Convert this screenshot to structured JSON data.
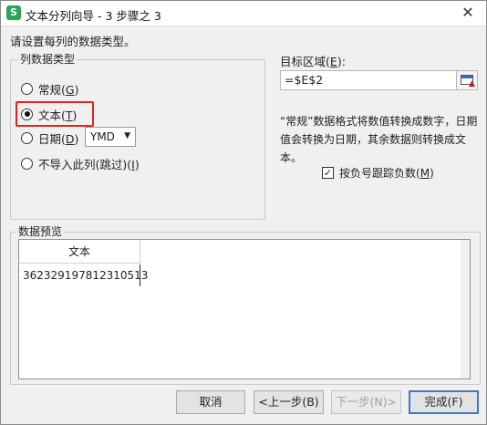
{
  "window": {
    "title": "文本分列向导 - 3 步骤之 3",
    "app_icon": "S",
    "close_glyph": "✕"
  },
  "instruction": "请设置每列的数据类型。",
  "column_type": {
    "legend": "列数据类型",
    "options": [
      {
        "label": "常规",
        "key": "G",
        "checked": false
      },
      {
        "label": "文本",
        "key": "T",
        "checked": true
      },
      {
        "label": "日期",
        "key": "D",
        "checked": false
      },
      {
        "label": "不导入此列(跳过)",
        "key": "I",
        "checked": false
      }
    ],
    "date_format": "YMD"
  },
  "destination": {
    "label": "目标区域",
    "key": "E",
    "value": "=$E$2"
  },
  "description": "“常规”数据格式将数值转换成数字，日期值会转换为日期，其余数据则转换成文本。",
  "negative_checkbox": {
    "label": "按负号跟踪负数",
    "key": "M",
    "checked": true
  },
  "preview": {
    "legend": "数据预览",
    "header": "文本",
    "value": "362329197812310513"
  },
  "buttons": {
    "cancel": "取消",
    "back": "<上一步(B)",
    "next": "下一步(N)>",
    "finish": "完成(F)"
  },
  "colors": {
    "highlight": "#e02424",
    "app_icon": "#2ca35a",
    "default_button_border": "#3b79d1"
  }
}
